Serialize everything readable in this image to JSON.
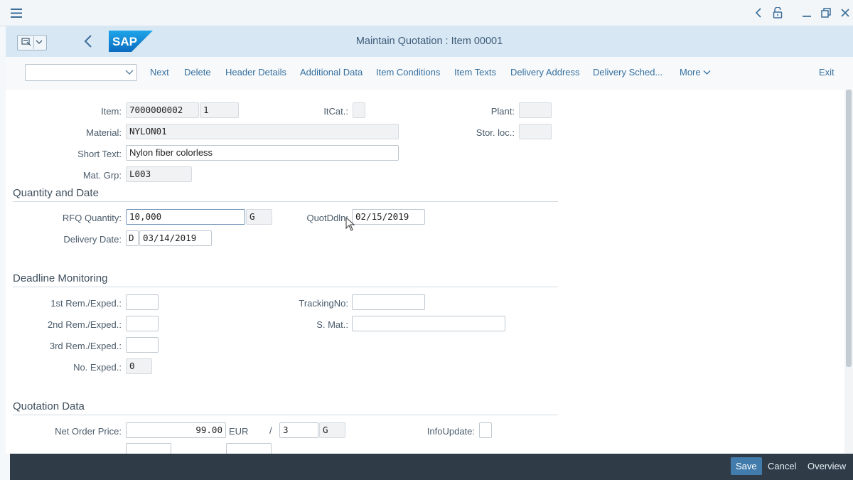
{
  "window": {
    "menu_icon": "hamburger-icon",
    "controls": [
      "chevron-left-icon",
      "unlock-icon",
      "minimize-icon",
      "restore-icon",
      "close-icon"
    ]
  },
  "shell": {
    "title": "Maintain Quotation : Item 00001",
    "logo_text": "SAP"
  },
  "toolbar": {
    "select_value": "",
    "buttons": {
      "next": "Next",
      "delete": "Delete",
      "header_details": "Header Details",
      "additional_data": "Additional Data",
      "item_conditions": "Item Conditions",
      "item_texts": "Item Texts",
      "delivery_address": "Delivery Address",
      "delivery_sched": "Delivery Sched...",
      "more": "More",
      "exit": "Exit"
    }
  },
  "item": {
    "item_label": "Item:",
    "item_value": "7000000002",
    "item_sub": "1",
    "itcat_label": "ItCat.:",
    "itcat_value": "",
    "plant_label": "Plant:",
    "plant_value": "",
    "material_label": "Material:",
    "material_value": "NYLON01",
    "storloc_label": "Stor. loc.:",
    "storloc_value": "",
    "short_text_label": "Short Text:",
    "short_text_value": "Nylon fiber colorless",
    "matgrp_label": "Mat. Grp:",
    "matgrp_value": "L003"
  },
  "qty_date": {
    "title": "Quantity and Date",
    "rfq_qty_label": "RFQ Quantity:",
    "rfq_qty_value": "10,000",
    "rfq_unit": "G",
    "quotddln_label": "QuotDdln:",
    "quotddln_value": "02/15/2019",
    "delivery_label": "Delivery Date:",
    "delivery_type": "D",
    "delivery_value": "03/14/2019"
  },
  "deadline": {
    "title": "Deadline Monitoring",
    "rem1_label": "1st Rem./Exped.:",
    "rem2_label": "2nd Rem./Exped.:",
    "rem3_label": "3rd Rem./Exped.:",
    "noexped_label": "No. Exped.:",
    "noexped_value": "0",
    "tracking_label": "TrackingNo:",
    "smat_label": "S. Mat.:"
  },
  "quotation": {
    "title": "Quotation Data",
    "net_price_label": "Net Order Price:",
    "net_price_value": "99.00",
    "currency": "EUR",
    "per_sep": "/",
    "per_value": "3",
    "per_unit": "G",
    "infoupdate_label": "InfoUpdate:"
  },
  "footer": {
    "save": "Save",
    "cancel": "Cancel",
    "overview": "Overview"
  },
  "colors": {
    "shell_bg": "#d7e7f4",
    "footer_bg": "#2f3c48",
    "primary_button": "#427cac",
    "link": "#3670a0"
  }
}
